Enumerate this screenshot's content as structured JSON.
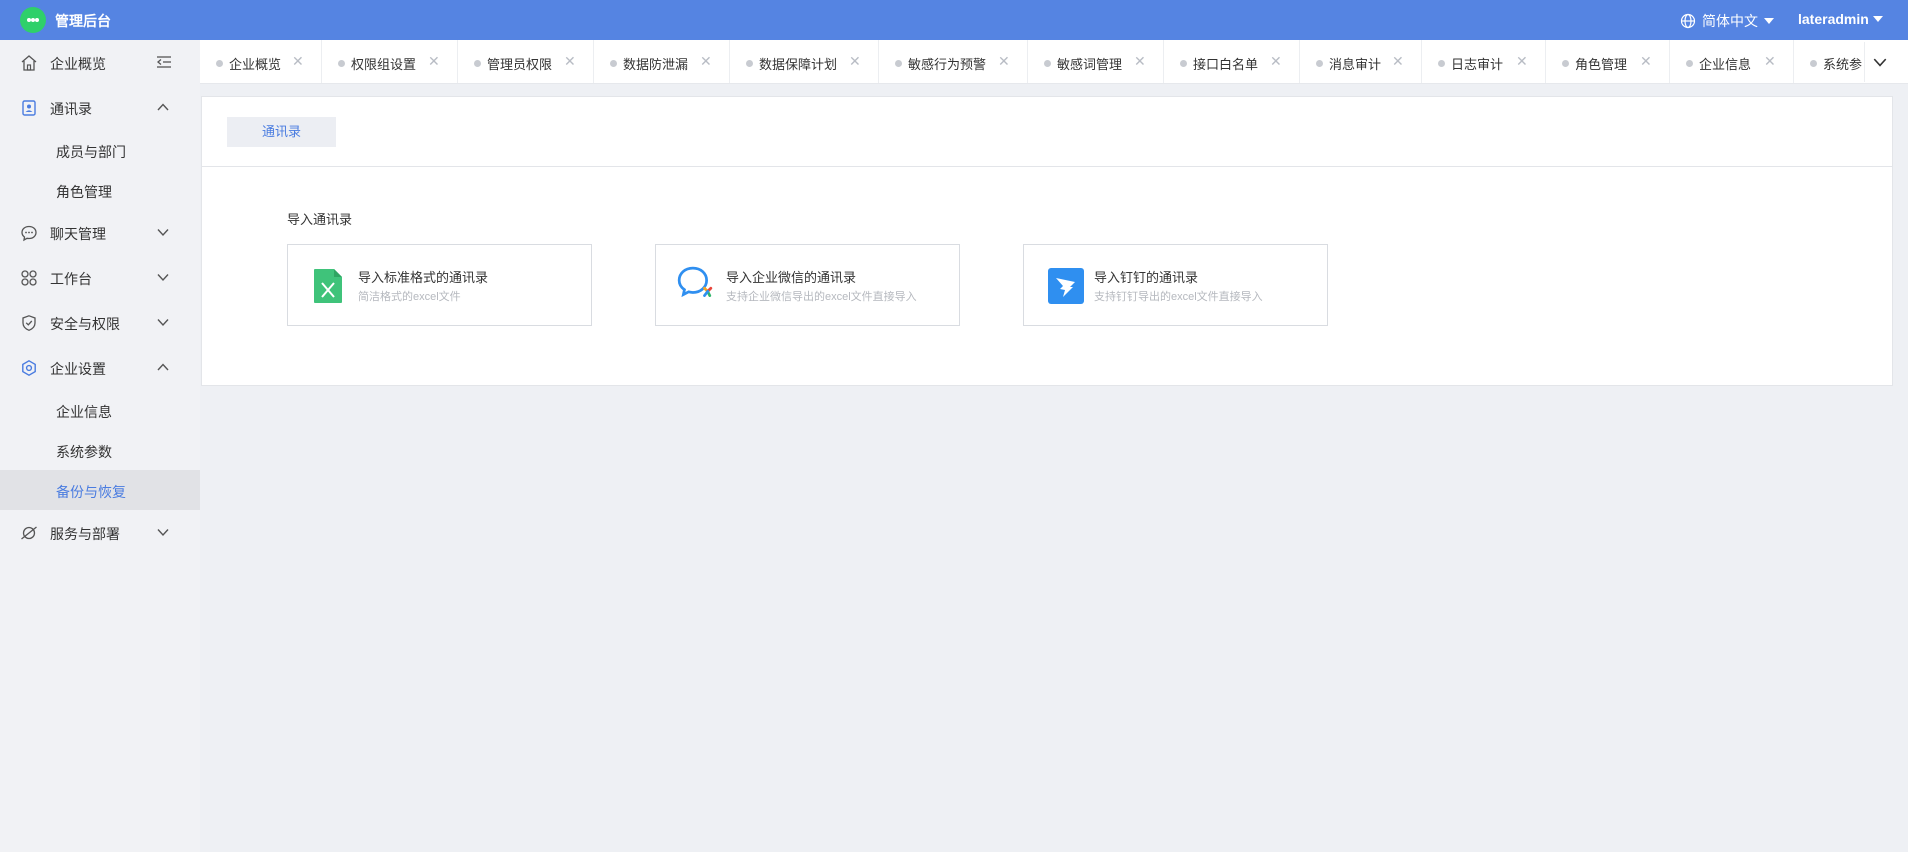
{
  "header": {
    "title": "管理后台",
    "language": "简体中文",
    "username": "lateradmin"
  },
  "sidebar": {
    "items": [
      {
        "label": "企业概览",
        "icon": "home-icon"
      },
      {
        "label": "通讯录",
        "icon": "contacts-icon",
        "expanded": true,
        "children": [
          "成员与部门",
          "角色管理"
        ]
      },
      {
        "label": "聊天管理",
        "icon": "chat-icon"
      },
      {
        "label": "工作台",
        "icon": "workbench-icon"
      },
      {
        "label": "安全与权限",
        "icon": "shield-icon"
      },
      {
        "label": "企业设置",
        "icon": "settings-icon",
        "expanded": true,
        "children": [
          "企业信息",
          "系统参数",
          "备份与恢复"
        ],
        "selected_child": "备份与恢复"
      },
      {
        "label": "服务与部署",
        "icon": "service-icon"
      }
    ]
  },
  "tabs": [
    "企业概览",
    "权限组设置",
    "管理员权限",
    "数据防泄漏",
    "数据保障计划",
    "敏感行为预警",
    "敏感词管理",
    "接口白名单",
    "消息审计",
    "日志审计",
    "角色管理",
    "企业信息",
    "系统参"
  ],
  "content": {
    "subtab": "通讯录",
    "section_title": "导入通讯录",
    "cards": [
      {
        "title": "导入标准格式的通讯录",
        "desc": "简洁格式的excel文件",
        "icon": "excel-icon"
      },
      {
        "title": "导入企业微信的通讯录",
        "desc": "支持企业微信导出的excel文件直接导入",
        "icon": "wecom-icon"
      },
      {
        "title": "导入钉钉的通讯录",
        "desc": "支持钉钉导出的excel文件直接导入",
        "icon": "dingtalk-icon"
      }
    ]
  },
  "colors": {
    "header_bg": "#5584e2",
    "accent": "#4a7ce0",
    "excel_green": "#3fc37a",
    "dingtalk_blue": "#2f8ff0"
  }
}
